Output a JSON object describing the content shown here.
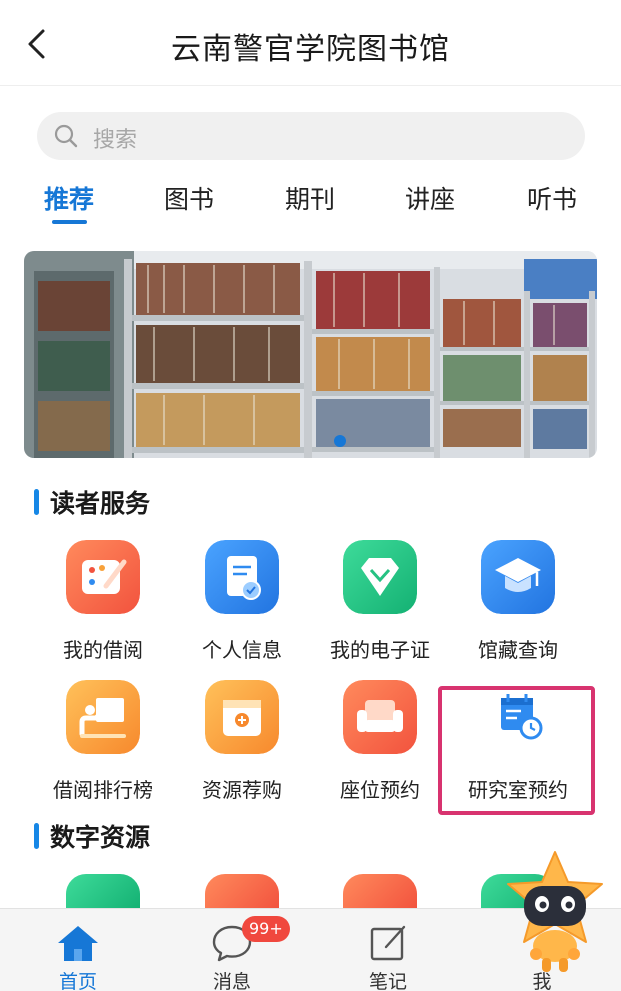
{
  "header": {
    "title": "云南警官学院图书馆",
    "back_icon": "chevron-left-icon"
  },
  "search": {
    "placeholder": "搜索",
    "icon": "search-icon"
  },
  "tabs": [
    {
      "label": "推荐",
      "active": true
    },
    {
      "label": "图书",
      "active": false
    },
    {
      "label": "期刊",
      "active": false
    },
    {
      "label": "讲座",
      "active": false
    },
    {
      "label": "听书",
      "active": false
    }
  ],
  "banner": {
    "slides": 1,
    "active_dot": 1
  },
  "reader_services": {
    "title": "读者服务",
    "items": [
      {
        "label": "我的借阅",
        "icon": "palette-icon",
        "color": "#f66a4f"
      },
      {
        "label": "个人信息",
        "icon": "profile-card-icon",
        "color": "#2f8bf0"
      },
      {
        "label": "我的电子证",
        "icon": "diamond-icon",
        "color": "#25c283"
      },
      {
        "label": "馆藏查询",
        "icon": "graduation-cap-icon",
        "color": "#2f8bf0"
      },
      {
        "label": "借阅排行榜",
        "icon": "teacher-board-icon",
        "color": "#f8a13a"
      },
      {
        "label": "资源荐购",
        "icon": "box-icon",
        "color": "#f8a13a"
      },
      {
        "label": "座位预约",
        "icon": "sofa-icon",
        "color": "#f66a4f"
      },
      {
        "label": "研究室预约",
        "icon": "calendar-clock-icon",
        "color": "#2f8bf0",
        "highlighted": true
      }
    ]
  },
  "digital_resources": {
    "title": "数字资源"
  },
  "tabbar": {
    "items": [
      {
        "label": "首页",
        "icon": "home-icon",
        "active": true
      },
      {
        "label": "消息",
        "icon": "chat-bubble-icon",
        "active": false
      },
      {
        "label": "笔记",
        "icon": "note-edit-icon",
        "active": false
      },
      {
        "label": "我",
        "icon": "user-icon",
        "active": false
      }
    ],
    "message_badge": "99+"
  },
  "colors": {
    "accent": "#1677d6",
    "highlight_border": "#d8336f",
    "badge": "#f0483e"
  }
}
